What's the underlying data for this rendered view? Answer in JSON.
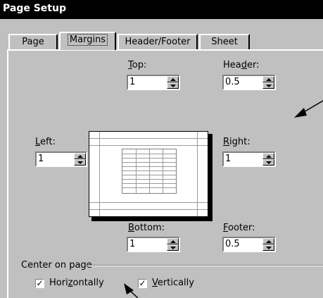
{
  "window": {
    "title": "Page Setup"
  },
  "tabs": [
    {
      "label": "Page"
    },
    {
      "label": "Margins"
    },
    {
      "label": "Header/Footer"
    },
    {
      "label": "Sheet"
    }
  ],
  "margins": {
    "top": {
      "label": "Top:",
      "value": "1"
    },
    "header": {
      "label": "Header:",
      "value": "0.5"
    },
    "left": {
      "label": "Left:",
      "value": "1"
    },
    "right": {
      "label": "Right:",
      "value": "1"
    },
    "bottom": {
      "label": "Bottom:",
      "value": "1"
    },
    "footer": {
      "label": "Footer:",
      "value": "0.5"
    }
  },
  "center": {
    "label": "Center on page",
    "horizontally": {
      "label": "Horizontally",
      "checked": true
    },
    "vertically": {
      "label": "Vertically",
      "checked": true
    }
  },
  "icons": [
    "spin-up-icon",
    "spin-down-icon",
    "check-icon",
    "arrow-pointer-icon"
  ]
}
